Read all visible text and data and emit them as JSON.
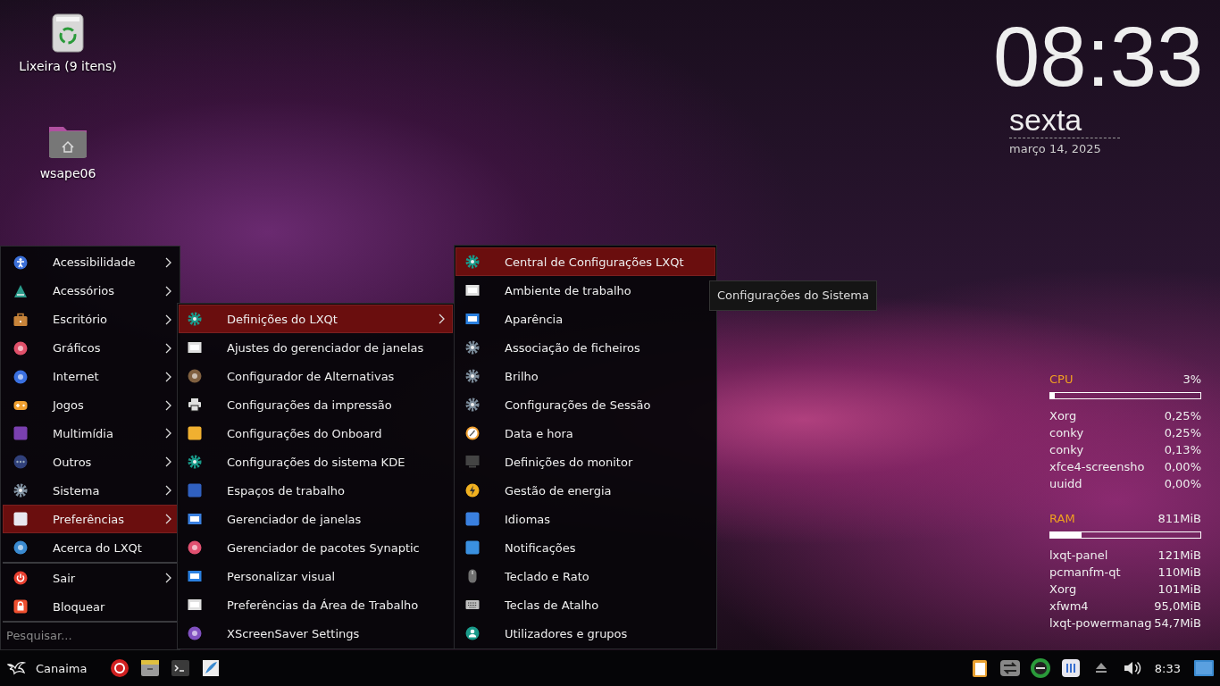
{
  "desktop_icons": [
    {
      "label": "Lixeira (9 itens)"
    },
    {
      "label": "wsape06"
    }
  ],
  "clock": {
    "time": "08:33",
    "weekday": "sexta",
    "date": "março 14, 2025"
  },
  "system_monitor": {
    "sections": [
      {
        "label": "CPU",
        "value": "3%",
        "level": 0.03,
        "processes": [
          {
            "name": "Xorg",
            "value": "0,25%"
          },
          {
            "name": "conky",
            "value": "0,25%"
          },
          {
            "name": "conky",
            "value": "0,13%"
          },
          {
            "name": "xfce4-screensho",
            "value": "0,00%"
          },
          {
            "name": "uuidd",
            "value": "0,00%"
          }
        ]
      },
      {
        "label": "RAM",
        "value": "811MiB",
        "level": 0.21,
        "processes": [
          {
            "name": "lxqt-panel",
            "value": "121MiB"
          },
          {
            "name": "pcmanfm-qt",
            "value": "110MiB"
          },
          {
            "name": "Xorg",
            "value": "101MiB"
          },
          {
            "name": "xfwm4",
            "value": "95,0MiB"
          },
          {
            "name": "lxqt-powermanag",
            "value": "54,7MiB"
          }
        ]
      }
    ]
  },
  "main_menu": {
    "sections": [
      [
        {
          "label": "Acessibilidade",
          "submenu": true,
          "selected": false
        },
        {
          "label": "Acessórios",
          "submenu": true,
          "selected": false
        },
        {
          "label": "Escritório",
          "submenu": true,
          "selected": false
        },
        {
          "label": "Gráficos",
          "submenu": true,
          "selected": false
        },
        {
          "label": "Internet",
          "submenu": true,
          "selected": false
        },
        {
          "label": "Jogos",
          "submenu": true,
          "selected": false
        },
        {
          "label": "Multimídia",
          "submenu": true,
          "selected": false
        },
        {
          "label": "Outros",
          "submenu": true,
          "selected": false
        },
        {
          "label": "Sistema",
          "submenu": true,
          "selected": false
        },
        {
          "label": "Preferências",
          "submenu": true,
          "selected": true
        },
        {
          "label": "Acerca do LXQt",
          "submenu": false,
          "selected": false
        }
      ],
      [
        {
          "label": "Sair",
          "submenu": true,
          "selected": false
        },
        {
          "label": "Bloquear",
          "submenu": false,
          "selected": false
        }
      ]
    ],
    "search": {
      "placeholder": "Pesquisar..."
    }
  },
  "submenu": {
    "items": [
      {
        "label": "Definições do LXQt",
        "submenu": true,
        "selected": true
      },
      {
        "label": "Ajustes do gerenciador de janelas",
        "submenu": false,
        "selected": false
      },
      {
        "label": "Configurador de Alternativas",
        "submenu": false,
        "selected": false
      },
      {
        "label": "Configurações da impressão",
        "submenu": false,
        "selected": false
      },
      {
        "label": "Configurações do Onboard",
        "submenu": false,
        "selected": false
      },
      {
        "label": "Configurações do sistema KDE",
        "submenu": false,
        "selected": false
      },
      {
        "label": "Espaços de trabalho",
        "submenu": false,
        "selected": false
      },
      {
        "label": "Gerenciador de janelas",
        "submenu": false,
        "selected": false
      },
      {
        "label": "Gerenciador de pacotes Synaptic",
        "submenu": false,
        "selected": false
      },
      {
        "label": "Personalizar visual",
        "submenu": false,
        "selected": false
      },
      {
        "label": "Preferências da Área de Trabalho",
        "submenu": false,
        "selected": false
      },
      {
        "label": "XScreenSaver Settings",
        "submenu": false,
        "selected": false
      }
    ]
  },
  "submenu_2": {
    "items": [
      {
        "label": "Central de Configurações LXQt",
        "submenu": false,
        "selected": true
      },
      {
        "label": "Ambiente de trabalho",
        "submenu": false,
        "selected": false
      },
      {
        "label": "Aparência",
        "submenu": false,
        "selected": false
      },
      {
        "label": "Associação de ficheiros",
        "submenu": false,
        "selected": false
      },
      {
        "label": "Brilho",
        "submenu": false,
        "selected": false
      },
      {
        "label": "Configurações de Sessão",
        "submenu": false,
        "selected": false
      },
      {
        "label": "Data e hora",
        "submenu": false,
        "selected": false
      },
      {
        "label": "Definições do monitor",
        "submenu": false,
        "selected": false
      },
      {
        "label": "Gestão de energia",
        "submenu": false,
        "selected": false
      },
      {
        "label": "Idiomas",
        "submenu": false,
        "selected": false
      },
      {
        "label": "Notificações",
        "submenu": false,
        "selected": false
      },
      {
        "label": "Teclado e Rato",
        "submenu": false,
        "selected": false
      },
      {
        "label": "Teclas de Atalho",
        "submenu": false,
        "selected": false
      },
      {
        "label": "Utilizadores e grupos",
        "submenu": false,
        "selected": false
      }
    ]
  },
  "tooltip": {
    "text": "Configurações do Sistema"
  },
  "taskbar": {
    "start_label": "Canaima",
    "time": "8:33"
  }
}
